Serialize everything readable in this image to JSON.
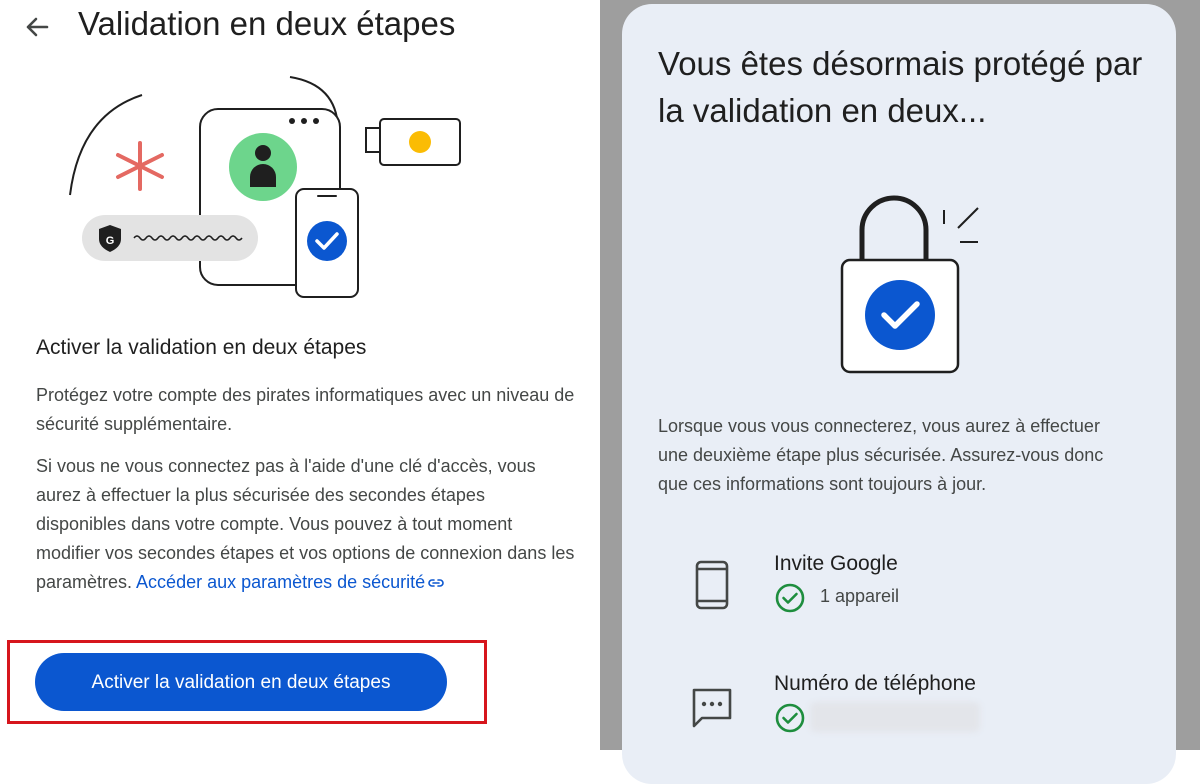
{
  "left": {
    "page_title": "Validation en deux étapes",
    "section_title": "Activer la validation en deux étapes",
    "paragraph1": "Protégez votre compte des pirates informatiques avec un niveau de sécurité supplémentaire.",
    "paragraph2_text": "Si vous ne vous connectez pas à l'aide d'une clé d'accès, vous aurez à effectuer la plus sécurisée des secondes étapes disponibles dans votre compte. Vous pouvez à tout moment modifier vos secondes étapes et vos options de connexion dans les paramètres. ",
    "paragraph2_link": "Accéder aux paramètres de sécurité",
    "primary_button": "Activer la validation en deux étapes",
    "illustration_text": "G",
    "icons": [
      "back-arrow-icon",
      "external-link-icon",
      "shield-icon",
      "person-icon",
      "checkmark-icon",
      "asterisk-icon",
      "security-key-icon"
    ]
  },
  "right": {
    "card_title": "Vous êtes désormais protégé par la validation en deux...",
    "card_paragraph": "Lorsque vous vous connecterez, vous aurez à effectuer une deuxième étape plus sécurisée. Assurez-vous donc que ces informations sont toujours à jour.",
    "methods": [
      {
        "title": "Invite Google",
        "subtitle": "1 appareil",
        "icon": "phone-icon"
      },
      {
        "title": "Numéro de téléphone",
        "subtitle": "",
        "icon": "sms-icon"
      }
    ]
  },
  "colors": {
    "accent": "#0b57d0",
    "highlight_border": "#d6151c",
    "card_bg": "#e9eef6",
    "check_green": "#1e8e3e",
    "asterisk_red": "#e46962",
    "badge_green": "#6dd58c",
    "key_yellow": "#fbbc04"
  }
}
